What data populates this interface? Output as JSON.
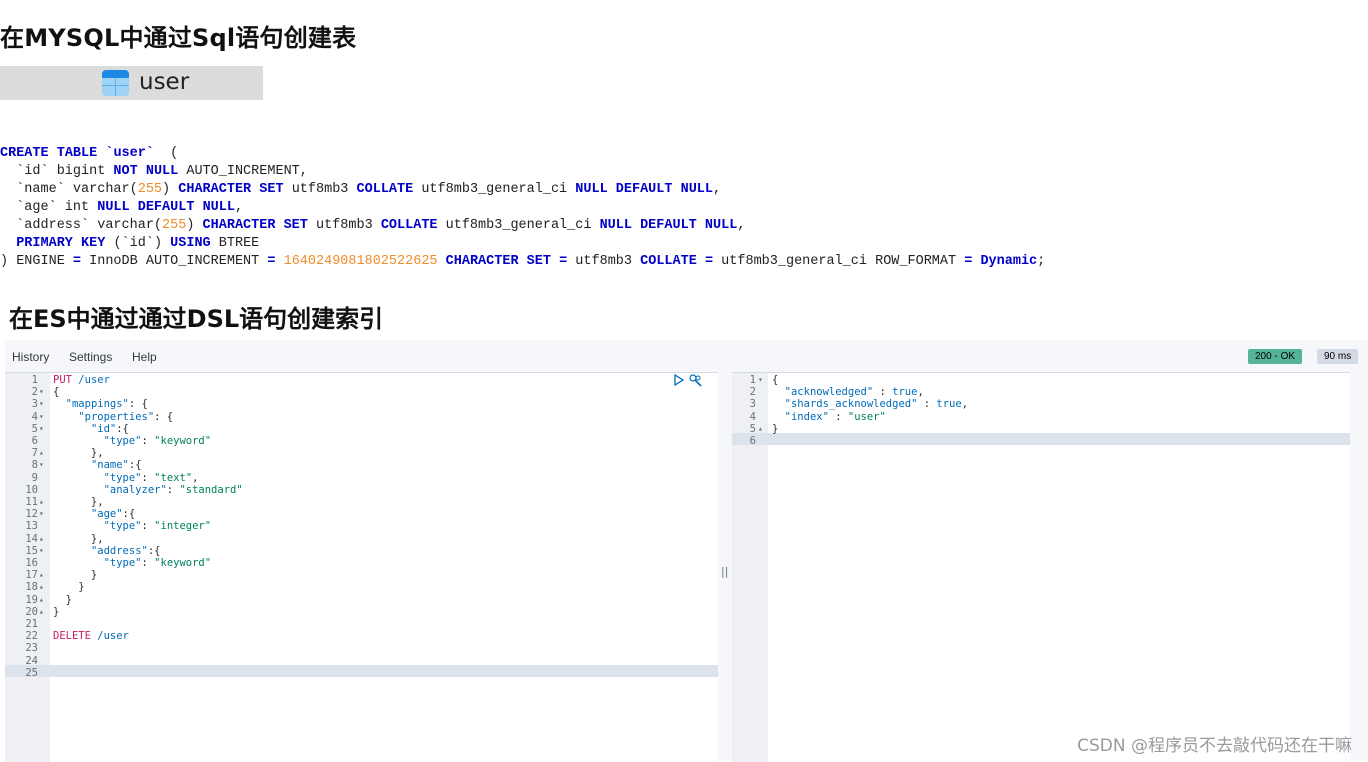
{
  "headings": {
    "mysql": "在MYSQL中通过Sql语句创建表",
    "es": "在ES中通过通过DSL语句创建索引"
  },
  "table_tab": {
    "name": "user",
    "icon": "database-table-icon"
  },
  "sql_lines": [
    "CREATE TABLE `user`  (",
    "  `id` bigint NOT NULL AUTO_INCREMENT,",
    "  `name` varchar(255) CHARACTER SET utf8mb3 COLLATE utf8mb3_general_ci NULL DEFAULT NULL,",
    "  `age` int NULL DEFAULT NULL,",
    "  `address` varchar(255) CHARACTER SET utf8mb3 COLLATE utf8mb3_general_ci NULL DEFAULT NULL,",
    "  PRIMARY KEY (`id`) USING BTREE",
    ") ENGINE = InnoDB AUTO_INCREMENT = 1640249081802522625 CHARACTER SET = utf8mb3 COLLATE = utf8mb3_general_ci ROW_FORMAT = Dynamic;"
  ],
  "console": {
    "menu": [
      "History",
      "Settings",
      "Help"
    ],
    "status_badge": "200 - OK",
    "time_badge": "90 ms",
    "status_color": "#54b399",
    "request_lines": [
      "PUT /user",
      "{",
      "  \"mappings\": {",
      "    \"properties\": {",
      "      \"id\":{",
      "        \"type\": \"keyword\"",
      "      },",
      "      \"name\":{",
      "        \"type\": \"text\",",
      "        \"analyzer\": \"standard\"",
      "      },",
      "      \"age\":{",
      "        \"type\": \"integer\"",
      "      },",
      "      \"address\":{",
      "        \"type\": \"keyword\"",
      "      }",
      "    }",
      "  }",
      "}",
      "",
      "DELETE /user",
      "",
      "",
      ""
    ],
    "request_folds": [
      "",
      "▾",
      "▾",
      "▾",
      "▾",
      "",
      "▴",
      "▾",
      "",
      "",
      "▴",
      "▾",
      "",
      "▴",
      "▾",
      "",
      "▴",
      "▴",
      "▴",
      "▴",
      "",
      "",
      "",
      "",
      ""
    ],
    "response_lines": [
      "{",
      "  \"acknowledged\" : true,",
      "  \"shards_acknowledged\" : true,",
      "  \"index\" : \"user\"",
      "}",
      ""
    ],
    "response_folds": [
      "▾",
      "",
      "",
      "",
      "▴",
      ""
    ],
    "icons": [
      "play-icon",
      "wrench-icon"
    ]
  },
  "watermark": "CSDN @程序员不去敲代码还在干嘛"
}
